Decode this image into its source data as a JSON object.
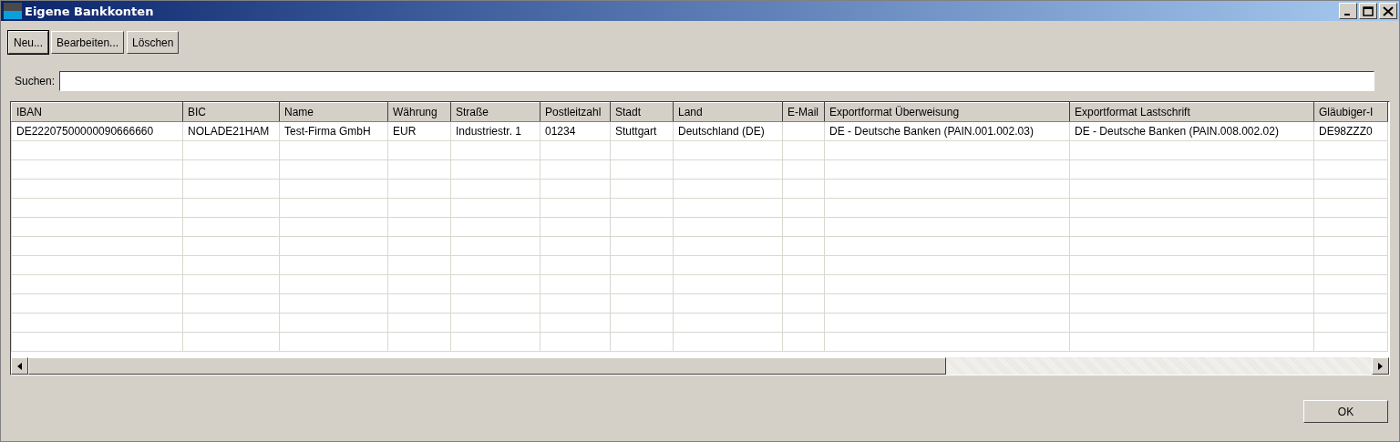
{
  "window": {
    "title": "Eigene Bankkonten"
  },
  "toolbar": {
    "buttons": [
      {
        "label": "Neu...",
        "default": true
      },
      {
        "label": "Bearbeiten...",
        "default": false
      },
      {
        "label": "Löschen",
        "default": false
      }
    ]
  },
  "search": {
    "label": "Suchen:"
  },
  "table": {
    "columns": [
      "IBAN",
      "BIC",
      "Name",
      "Währung",
      "Straße",
      "Postleitzahl",
      "Stadt",
      "Land",
      "E-Mail",
      "Exportformat Überweisung",
      "Exportformat Lastschrift",
      "Gläubiger-I"
    ],
    "rows": [
      {
        "cells": [
          "DE22207500000090666660",
          "NOLADE21HAM",
          "Test-Firma GmbH",
          "EUR",
          "Industriestr. 1",
          "01234",
          "Stuttgart",
          "Deutschland (DE)",
          "",
          "DE - Deutsche Banken (PAIN.001.002.03)",
          "DE - Deutsche Banken (PAIN.008.002.02)",
          "DE98ZZZ0"
        ]
      }
    ]
  },
  "footer": {
    "buttons": [
      "OK"
    ]
  }
}
